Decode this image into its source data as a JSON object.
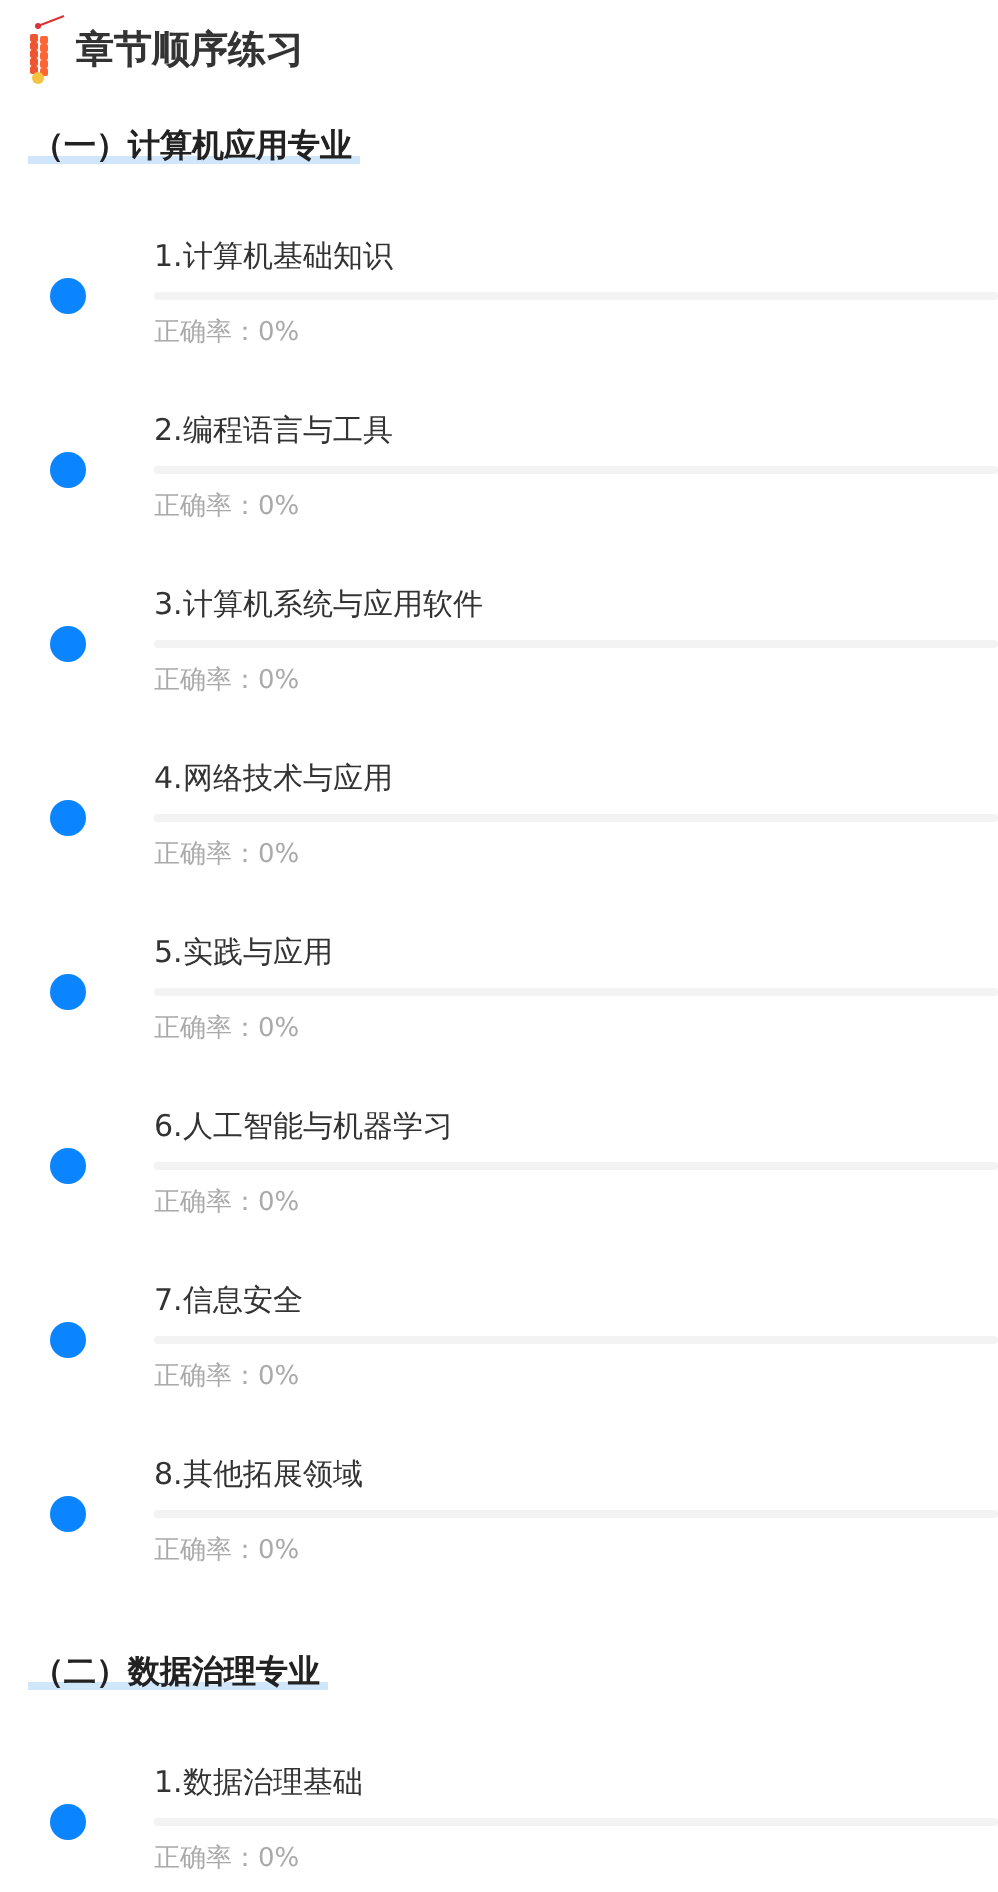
{
  "title": "章节顺序练习",
  "sections": [
    {
      "heading": "（一）计算机应用专业",
      "chapters": [
        {
          "name": "1.计算机基础知识",
          "accuracy": "正确率：0%",
          "level": 0
        },
        {
          "name": "2.编程语言与工具",
          "accuracy": "正确率：0%",
          "level": 0
        },
        {
          "name": "3.计算机系统与应用软件",
          "accuracy": "正确率：0%",
          "level": 0
        },
        {
          "name": "4.网络技术与应用",
          "accuracy": "正确率：0%",
          "level": 0
        },
        {
          "name": "5.实践与应用",
          "accuracy": "正确率：0%",
          "level": 0
        },
        {
          "name": "6.人工智能与机器学习",
          "accuracy": "正确率：0%",
          "level": 0
        },
        {
          "name": "7.信息安全",
          "accuracy": "正确率：0%",
          "level": 0
        },
        {
          "name": "8.其他拓展领域",
          "accuracy": "正确率：0%",
          "level": 0
        }
      ]
    },
    {
      "heading": "（二）数据治理专业",
      "chapters": [
        {
          "name": "1.数据治理基础",
          "accuracy": "正确率：0%",
          "level": 0
        }
      ]
    }
  ]
}
